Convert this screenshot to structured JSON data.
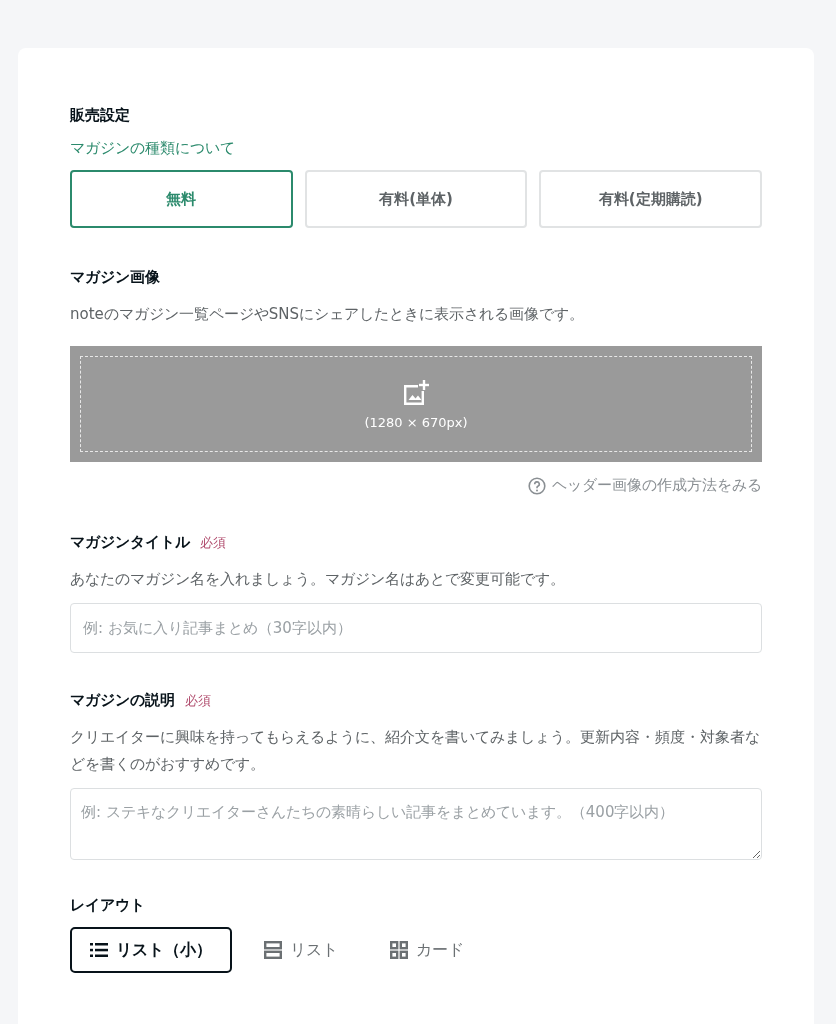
{
  "sales": {
    "heading": "販売設定",
    "link": "マガジンの種類について",
    "types": [
      {
        "label": "無料",
        "selected": true
      },
      {
        "label": "有料(単体)",
        "selected": false
      },
      {
        "label": "有料(定期購読)",
        "selected": false
      }
    ]
  },
  "image": {
    "heading": "マガジン画像",
    "description": "noteのマガジン一覧ページやSNSにシェアしたときに表示される画像です。",
    "size": "(1280 × 670px)",
    "help_link": "ヘッダー画像の作成方法をみる"
  },
  "title": {
    "heading": "マガジンタイトル",
    "required": "必須",
    "description": "あなたのマガジン名を入れましょう。マガジン名はあとで変更可能です。",
    "placeholder": "例: お気に入り記事まとめ（30字以内）"
  },
  "summary": {
    "heading": "マガジンの説明",
    "required": "必須",
    "description": "クリエイターに興味を持ってもらえるように、紹介文を書いてみましょう。更新内容・頻度・対象者などを書くのがおすすめです。",
    "placeholder": "例: ステキなクリエイターさんたちの素晴らしい記事をまとめています。（400字以内）"
  },
  "layout": {
    "heading": "レイアウト",
    "options": [
      {
        "kind": "list-small",
        "label": "リスト（小）",
        "selected": true
      },
      {
        "kind": "list",
        "label": "リスト",
        "selected": false
      },
      {
        "kind": "card",
        "label": "カード",
        "selected": false
      }
    ]
  }
}
